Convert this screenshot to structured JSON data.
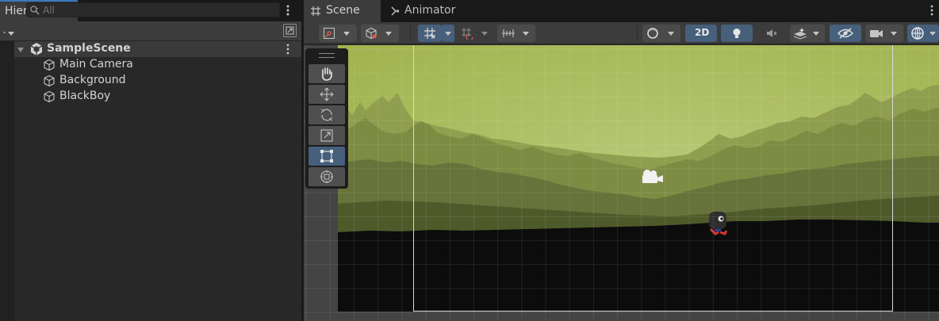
{
  "hierarchy": {
    "tab_title": "Hierarchy",
    "search_placeholder": "All",
    "scene_name": "SampleScene",
    "items": [
      {
        "label": "Main Camera"
      },
      {
        "label": "Background"
      },
      {
        "label": "BlackBoy"
      }
    ]
  },
  "scene_view": {
    "tabs": [
      {
        "label": "Scene"
      },
      {
        "label": "Animator"
      }
    ],
    "toolbar": {
      "mode_2d_label": "2D"
    },
    "tools": [
      "hand",
      "move",
      "rotate",
      "scale",
      "rect",
      "transform"
    ],
    "active_tool": "rect"
  },
  "colors": {
    "accent": "#3a79bb",
    "toggle_on": "#46607c",
    "sky_light": "#b6c971",
    "sky_top": "#a7b852",
    "ground": "#0c0c0c"
  }
}
